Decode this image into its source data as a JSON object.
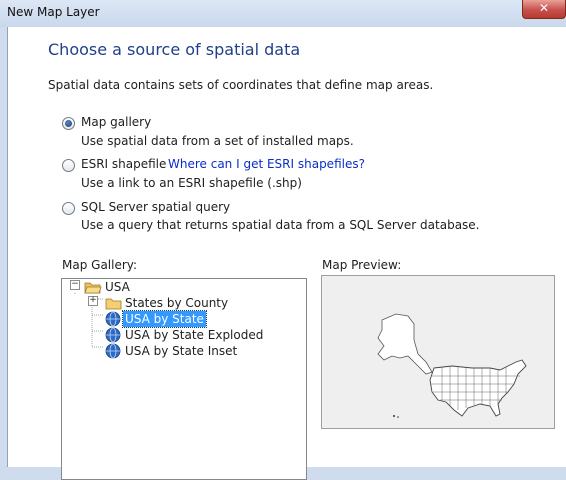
{
  "window": {
    "title": "New Map Layer",
    "close_symbol": "✕"
  },
  "page": {
    "heading": "Choose a source of spatial data",
    "description": "Spatial data contains sets of coordinates that define map areas."
  },
  "options": [
    {
      "label": "Map gallery",
      "description": "Use spatial data from a set of installed maps.",
      "selected": true
    },
    {
      "label": "ESRI shapefile",
      "link": "Where can I get ESRI shapefiles?",
      "description": "Use a link to an ESRI shapefile (.shp)",
      "selected": false
    },
    {
      "label": "SQL Server spatial query",
      "description": "Use a query that returns spatial data from a SQL Server database.",
      "selected": false
    }
  ],
  "gallery": {
    "label": "Map Gallery:",
    "root": {
      "label": "USA",
      "expanded": true,
      "icon": "folder-open-icon"
    },
    "children": [
      {
        "label": "States by County",
        "icon": "folder-icon",
        "expander": "+"
      },
      {
        "label": "USA by State",
        "icon": "globe-icon",
        "selected": true
      },
      {
        "label": "USA by State Exploded",
        "icon": "globe-icon"
      },
      {
        "label": "USA by State Inset",
        "icon": "globe-icon"
      }
    ]
  },
  "preview": {
    "label": "Map Preview:"
  },
  "colors": {
    "heading": "#1f3f8b",
    "link": "#0a2ec7",
    "selection": "#3399ff"
  }
}
